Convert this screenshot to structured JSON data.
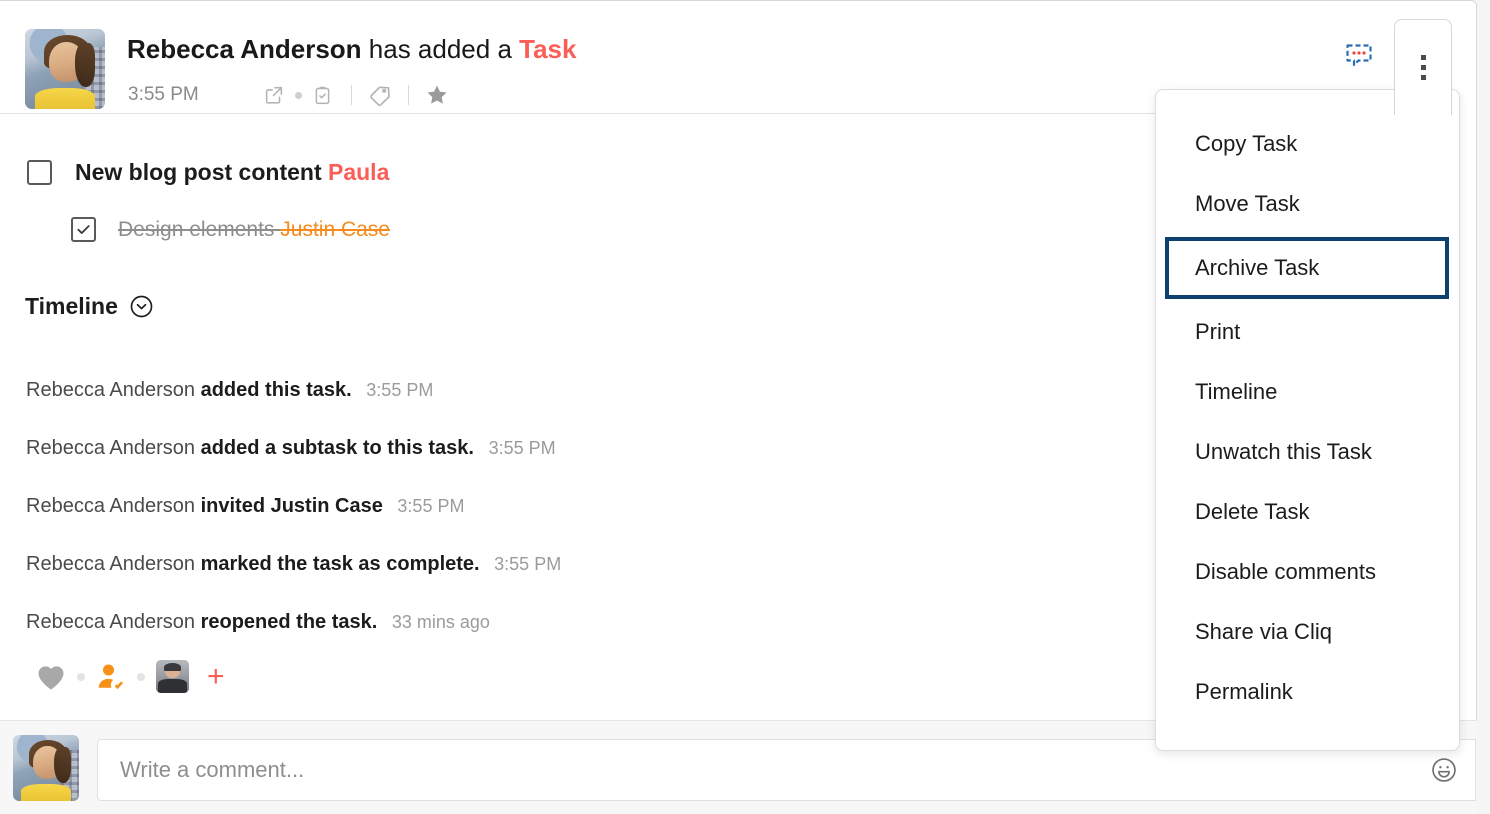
{
  "header": {
    "author": "Rebecca Anderson",
    "middle": " has added a ",
    "kind": "Task",
    "time": "3:55 PM",
    "icons": [
      "external-link-icon",
      "status-dot-icon",
      "clipboard-check-icon",
      "tag-icon",
      "star-icon"
    ],
    "comment_button": "comment-bubble-icon",
    "kebab_button": "more-options-icon"
  },
  "task": {
    "title": "New blog post content",
    "assignee": "Paula",
    "checked": false,
    "subtask": {
      "title": "Design elements",
      "assignee": "Justin Case",
      "checked": true
    }
  },
  "timeline": {
    "heading": "Timeline",
    "toggle_icon": "chevron-down-circle-icon",
    "entries": [
      {
        "actor": "Rebecca Anderson",
        "action": "added this task.",
        "time": "3:55 PM"
      },
      {
        "actor": "Rebecca Anderson",
        "action": "added a subtask to this task.",
        "time": "3:55 PM"
      },
      {
        "actor": "Rebecca Anderson",
        "action": "invited Justin Case",
        "time": "3:55 PM"
      },
      {
        "actor": "Rebecca Anderson",
        "action": "marked the task as complete.",
        "time": "3:55 PM"
      },
      {
        "actor": "Rebecca Anderson",
        "action": "reopened the task.",
        "time": "33 mins ago"
      }
    ]
  },
  "reactions": {
    "items": [
      "heart-icon",
      "person-check-icon",
      "user-avatar"
    ],
    "add_label": "+"
  },
  "comment": {
    "placeholder": "Write a comment...",
    "value": "",
    "emoji_icon": "emoji-smiley-icon"
  },
  "menu": {
    "items": [
      {
        "label": "Copy Task",
        "highlighted": false
      },
      {
        "label": "Move Task",
        "highlighted": false
      },
      {
        "label": "Archive Task",
        "highlighted": true
      },
      {
        "label": "Print",
        "highlighted": false
      },
      {
        "label": "Timeline",
        "highlighted": false
      },
      {
        "label": "Unwatch this Task",
        "highlighted": false
      },
      {
        "label": "Delete Task",
        "highlighted": false
      },
      {
        "label": "Disable comments",
        "highlighted": false
      },
      {
        "label": "Share via Cliq",
        "highlighted": false
      },
      {
        "label": "Permalink",
        "highlighted": false
      }
    ]
  },
  "colors": {
    "accent_red": "#fb5d57",
    "assignee_orange": "#f68b1f",
    "highlight_border": "#0d4270",
    "comment_icon_blue": "#2b6cb5"
  }
}
